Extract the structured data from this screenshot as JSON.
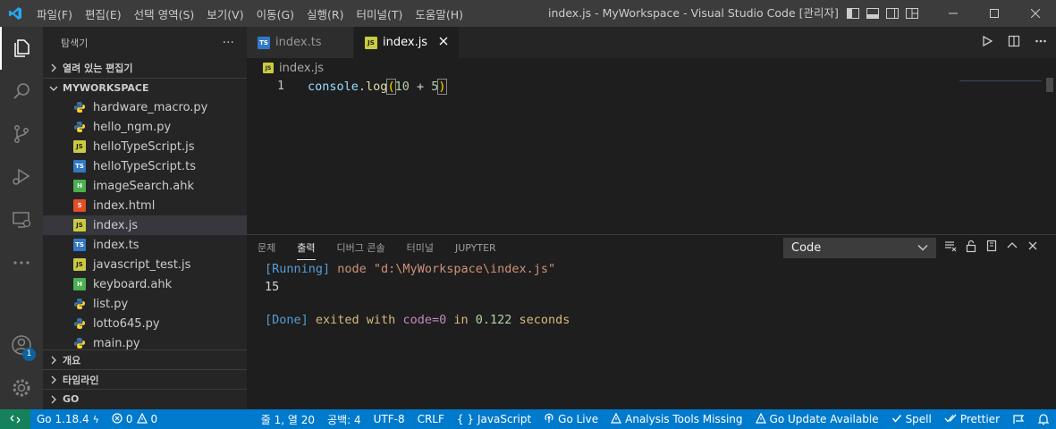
{
  "menu": [
    "파일(F)",
    "편집(E)",
    "선택 영역(S)",
    "보기(V)",
    "이동(G)",
    "실행(R)",
    "터미널(T)",
    "도움말(H)"
  ],
  "window_title": "index.js - MyWorkspace - Visual Studio Code [관리자]",
  "sidebar": {
    "title": "탐색기",
    "more": "···",
    "open_editors": "열려 있는 편집기",
    "workspace": "MYWORKSPACE",
    "files": [
      {
        "name": "hardware_macro.py",
        "type": "py"
      },
      {
        "name": "hello_ngm.py",
        "type": "py"
      },
      {
        "name": "helloTypeScript.js",
        "type": "js"
      },
      {
        "name": "helloTypeScript.ts",
        "type": "ts"
      },
      {
        "name": "imageSearch.ahk",
        "type": "ahk"
      },
      {
        "name": "index.html",
        "type": "html"
      },
      {
        "name": "index.js",
        "type": "js",
        "selected": true
      },
      {
        "name": "index.ts",
        "type": "ts"
      },
      {
        "name": "javascript_test.js",
        "type": "js"
      },
      {
        "name": "keyboard.ahk",
        "type": "ahk"
      },
      {
        "name": "list.py",
        "type": "py"
      },
      {
        "name": "lotto645.py",
        "type": "py"
      },
      {
        "name": "main.py",
        "type": "py"
      }
    ],
    "outline": "개요",
    "timeline": "타임라인",
    "go": "GO"
  },
  "activity_badge": "1",
  "tabs": [
    {
      "label": "index.ts",
      "type": "ts",
      "active": false
    },
    {
      "label": "index.js",
      "type": "js",
      "active": true
    }
  ],
  "breadcrumb": "index.js",
  "editor": {
    "line_number": "1",
    "code": {
      "fn": "console",
      "dot": ".",
      "method": "log",
      "open": "(",
      "num1": "10",
      "op": " + ",
      "num2": "5",
      "close": ")"
    }
  },
  "panel": {
    "tabs": [
      "문제",
      "출력",
      "디버그 콘솔",
      "터미널",
      "JUPYTER"
    ],
    "active_tab": "출력",
    "channel": "Code",
    "output": {
      "running_tag": "[Running]",
      "running_cmd": " node \"d:\\MyWorkspace\\index.js\"",
      "result": "15",
      "done_tag": "[Done]",
      "done_text1": " exited with ",
      "done_code": "code=0",
      "done_text2": " in ",
      "done_time": "0.122",
      "done_text3": " seconds"
    }
  },
  "status": {
    "go_version": "Go 1.18.4",
    "errors": "0",
    "warnings": "0",
    "position": "줄 1, 열 20",
    "spaces": "공백: 4",
    "encoding": "UTF-8",
    "eol": "CRLF",
    "language": "JavaScript",
    "go_live": "Go Live",
    "analysis": "Analysis Tools Missing",
    "go_update": "Go Update Available",
    "spell": "Spell",
    "prettier": "Prettier"
  },
  "colors": {
    "statusbar": "#007acc",
    "remote": "#16825d",
    "running": "#569cd6",
    "done_text": "#c586c0",
    "number": "#b5cea8"
  }
}
